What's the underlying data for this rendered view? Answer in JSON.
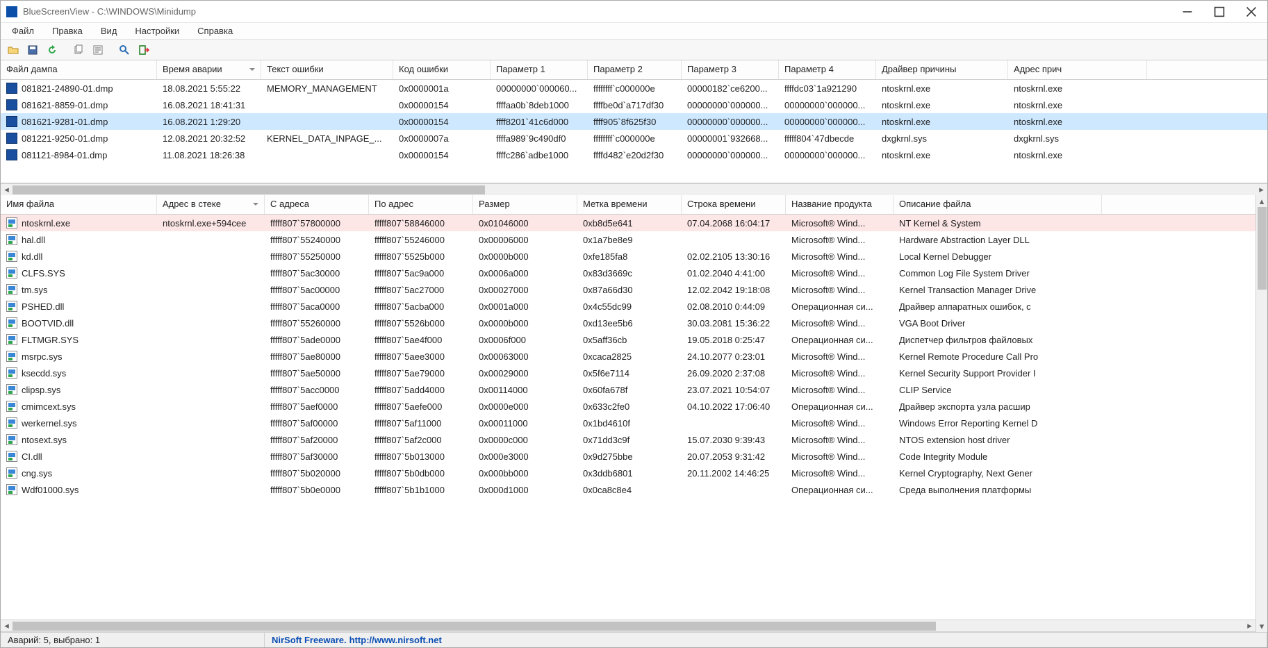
{
  "window": {
    "title": "BlueScreenView  -  C:\\WINDOWS\\Minidump"
  },
  "menubar": [
    "Файл",
    "Правка",
    "Вид",
    "Настройки",
    "Справка"
  ],
  "top_grid": {
    "headers": [
      "Файл дампа",
      "Время аварии",
      "Текст ошибки",
      "Код ошибки",
      "Параметр 1",
      "Параметр 2",
      "Параметр 3",
      "Параметр 4",
      "Драйвер причины",
      "Адрес прич"
    ],
    "sort_col": 1,
    "rows": [
      {
        "sel": false,
        "c": [
          "081821-24890-01.dmp",
          "18.08.2021 5:55:22",
          "MEMORY_MANAGEMENT",
          "0x0000001a",
          "00000000`000060...",
          "ffffffff`c000000e",
          "00000182`ce6200...",
          "ffffdc03`1a921290",
          "ntoskrnl.exe",
          "ntoskrnl.exe"
        ]
      },
      {
        "sel": false,
        "c": [
          "081621-8859-01.dmp",
          "16.08.2021 18:41:31",
          "",
          "0x00000154",
          "ffffaa0b`8deb1000",
          "ffffbe0d`a717df30",
          "00000000`000000...",
          "00000000`000000...",
          "ntoskrnl.exe",
          "ntoskrnl.exe"
        ]
      },
      {
        "sel": true,
        "c": [
          "081621-9281-01.dmp",
          "16.08.2021 1:29:20",
          "",
          "0x00000154",
          "ffff8201`41c6d000",
          "ffff905`8f625f30",
          "00000000`000000...",
          "00000000`000000...",
          "ntoskrnl.exe",
          "ntoskrnl.exe"
        ]
      },
      {
        "sel": false,
        "c": [
          "081221-9250-01.dmp",
          "12.08.2021 20:32:52",
          "KERNEL_DATA_INPAGE_...",
          "0x0000007a",
          "ffffa989`9c490df0",
          "ffffffff`c000000e",
          "00000001`932668...",
          "fffff804`47dbecde",
          "dxgkrnl.sys",
          "dxgkrnl.sys"
        ]
      },
      {
        "sel": false,
        "c": [
          "081121-8984-01.dmp",
          "11.08.2021 18:26:38",
          "",
          "0x00000154",
          "ffffc286`adbe1000",
          "ffffd482`e20d2f30",
          "00000000`000000...",
          "00000000`000000...",
          "ntoskrnl.exe",
          "ntoskrnl.exe"
        ]
      }
    ]
  },
  "bottom_grid": {
    "headers": [
      "Имя файла",
      "Адрес в стеке",
      "С адреса",
      "По адрес",
      "Размер",
      "Метка времени",
      "Строка времени",
      "Название продукта",
      "Описание файла"
    ],
    "sort_col": 1,
    "rows": [
      {
        "hl": true,
        "c": [
          "ntoskrnl.exe",
          "ntoskrnl.exe+594cee",
          "fffff807`57800000",
          "fffff807`58846000",
          "0x01046000",
          "0xb8d5e641",
          "07.04.2068 16:04:17",
          "Microsoft® Wind...",
          "NT Kernel & System"
        ]
      },
      {
        "hl": false,
        "c": [
          "hal.dll",
          "",
          "fffff807`55240000",
          "fffff807`55246000",
          "0x00006000",
          "0x1a7be8e9",
          "",
          "Microsoft® Wind...",
          "Hardware Abstraction Layer DLL"
        ]
      },
      {
        "hl": false,
        "c": [
          "kd.dll",
          "",
          "fffff807`55250000",
          "fffff807`5525b000",
          "0x0000b000",
          "0xfe185fa8",
          "02.02.2105 13:30:16",
          "Microsoft® Wind...",
          "Local Kernel Debugger"
        ]
      },
      {
        "hl": false,
        "c": [
          "CLFS.SYS",
          "",
          "fffff807`5ac30000",
          "fffff807`5ac9a000",
          "0x0006a000",
          "0x83d3669c",
          "01.02.2040 4:41:00",
          "Microsoft® Wind...",
          "Common Log File System Driver"
        ]
      },
      {
        "hl": false,
        "c": [
          "tm.sys",
          "",
          "fffff807`5ac00000",
          "fffff807`5ac27000",
          "0x00027000",
          "0x87a66d30",
          "12.02.2042 19:18:08",
          "Microsoft® Wind...",
          "Kernel Transaction Manager Drive"
        ]
      },
      {
        "hl": false,
        "c": [
          "PSHED.dll",
          "",
          "fffff807`5aca0000",
          "fffff807`5acba000",
          "0x0001a000",
          "0x4c55dc99",
          "02.08.2010 0:44:09",
          "Операционная си...",
          "Драйвер аппаратных ошибок, с"
        ]
      },
      {
        "hl": false,
        "c": [
          "BOOTVID.dll",
          "",
          "fffff807`55260000",
          "fffff807`5526b000",
          "0x0000b000",
          "0xd13ee5b6",
          "30.03.2081 15:36:22",
          "Microsoft® Wind...",
          "VGA Boot Driver"
        ]
      },
      {
        "hl": false,
        "c": [
          "FLTMGR.SYS",
          "",
          "fffff807`5ade0000",
          "fffff807`5ae4f000",
          "0x0006f000",
          "0x5aff36cb",
          "19.05.2018 0:25:47",
          "Операционная си...",
          "Диспетчер фильтров файловых"
        ]
      },
      {
        "hl": false,
        "c": [
          "msrpc.sys",
          "",
          "fffff807`5ae80000",
          "fffff807`5aee3000",
          "0x00063000",
          "0xcaca2825",
          "24.10.2077 0:23:01",
          "Microsoft® Wind...",
          "Kernel Remote Procedure Call Pro"
        ]
      },
      {
        "hl": false,
        "c": [
          "ksecdd.sys",
          "",
          "fffff807`5ae50000",
          "fffff807`5ae79000",
          "0x00029000",
          "0x5f6e7114",
          "26.09.2020 2:37:08",
          "Microsoft® Wind...",
          "Kernel Security Support Provider I"
        ]
      },
      {
        "hl": false,
        "c": [
          "clipsp.sys",
          "",
          "fffff807`5acc0000",
          "fffff807`5add4000",
          "0x00114000",
          "0x60fa678f",
          "23.07.2021 10:54:07",
          "Microsoft® Wind...",
          "CLIP Service"
        ]
      },
      {
        "hl": false,
        "c": [
          "cmimcext.sys",
          "",
          "fffff807`5aef0000",
          "fffff807`5aefe000",
          "0x0000e000",
          "0x633c2fe0",
          "04.10.2022 17:06:40",
          "Операционная си...",
          "Драйвер экспорта узла расшир"
        ]
      },
      {
        "hl": false,
        "c": [
          "werkernel.sys",
          "",
          "fffff807`5af00000",
          "fffff807`5af11000",
          "0x00011000",
          "0x1bd4610f",
          "",
          "Microsoft® Wind...",
          "Windows Error Reporting Kernel D"
        ]
      },
      {
        "hl": false,
        "c": [
          "ntosext.sys",
          "",
          "fffff807`5af20000",
          "fffff807`5af2c000",
          "0x0000c000",
          "0x71dd3c9f",
          "15.07.2030 9:39:43",
          "Microsoft® Wind...",
          "NTOS extension host driver"
        ]
      },
      {
        "hl": false,
        "c": [
          "CI.dll",
          "",
          "fffff807`5af30000",
          "fffff807`5b013000",
          "0x000e3000",
          "0x9d275bbe",
          "20.07.2053 9:31:42",
          "Microsoft® Wind...",
          "Code Integrity Module"
        ]
      },
      {
        "hl": false,
        "c": [
          "cng.sys",
          "",
          "fffff807`5b020000",
          "fffff807`5b0db000",
          "0x000bb000",
          "0x3ddb6801",
          "20.11.2002 14:46:25",
          "Microsoft® Wind...",
          "Kernel Cryptography, Next Gener"
        ]
      },
      {
        "hl": false,
        "c": [
          "Wdf01000.sys",
          "",
          "fffff807`5b0e0000",
          "fffff807`5b1b1000",
          "0x000d1000",
          "0x0ca8c8e4",
          "",
          "Операционная си...",
          "Среда выполнения платформы"
        ]
      }
    ]
  },
  "status": {
    "left": "Аварий: 5, выбрано: 1",
    "link_pre": "NirSoft Freeware.",
    "link": "http://www.nirsoft.net"
  }
}
